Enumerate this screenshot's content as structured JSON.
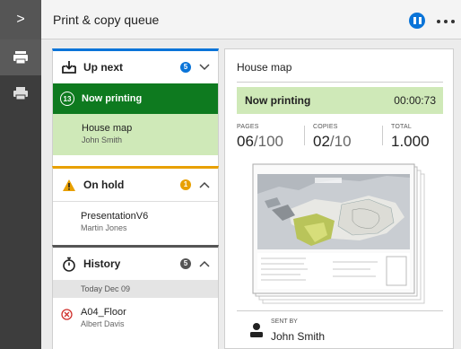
{
  "header": {
    "title": "Print & copy queue",
    "pause_icon": "pause-circle-icon",
    "more_icon": "more-horizontal-icon"
  },
  "rail": {
    "toggle_glyph": ">",
    "items": [
      {
        "icon": "printer-queue-icon",
        "active": true
      },
      {
        "icon": "printer-icon",
        "active": false
      }
    ]
  },
  "queue": {
    "up_next": {
      "title": "Up next",
      "count": "5",
      "badge_color": "#0a74d8",
      "expanded": true
    },
    "now_printing": {
      "title": "Now printing",
      "number": "13",
      "job": {
        "name": "House map",
        "owner": "John Smith"
      }
    },
    "on_hold": {
      "title": "On hold",
      "count": "1",
      "badge_color": "#e8a000",
      "expanded": true,
      "jobs": [
        {
          "name": "PresentationV6",
          "owner": "Martin Jones"
        }
      ]
    },
    "history": {
      "title": "History",
      "count": "5",
      "badge_color": "#555555",
      "expanded": true,
      "date": "Today Dec 09",
      "jobs": [
        {
          "name": "A04_Floor",
          "owner": "Albert Davis",
          "status": "error"
        }
      ]
    }
  },
  "preview": {
    "title": "House map",
    "status": "Now printing",
    "elapsed": "00:00:73",
    "pages": {
      "label": "PAGES",
      "current": "06",
      "total": "/100"
    },
    "copies": {
      "label": "COPIES",
      "current": "02",
      "total": "/10"
    },
    "total": {
      "label": "TOTAL",
      "value": "1.000"
    },
    "sent_by": {
      "label": "SENT BY",
      "name": "John Smith"
    }
  },
  "colors": {
    "accent": "#0a74d8",
    "printing_green": "#0e7a1f",
    "printing_light": "#cfe9b8",
    "hold_orange": "#e8a000",
    "error_red": "#d0312d"
  }
}
